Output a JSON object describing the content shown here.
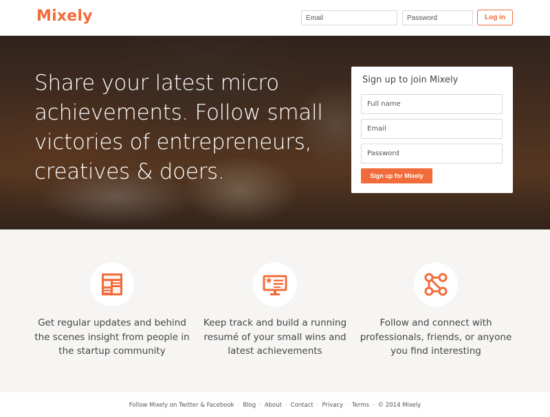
{
  "header": {
    "logo": "Mixely",
    "email_placeholder": "Email",
    "password_placeholder": "Password",
    "login_label": "Log in"
  },
  "hero": {
    "headline": "Share your latest micro achievements. Follow small victories of entrepreneurs, creatives & doers."
  },
  "signup": {
    "title": "Sign up to join Mixely",
    "fullname_placeholder": "Full name",
    "email_placeholder": "Email",
    "password_placeholder": "Password",
    "button_label": "Sign up for Mixely"
  },
  "features": [
    {
      "icon": "news-feed-icon",
      "text": "Get regular updates and behind the scenes insight from people in the startup community"
    },
    {
      "icon": "achievement-screen-icon",
      "text": "Keep track and build a running resumé of your small wins and latest achievements"
    },
    {
      "icon": "connections-icon",
      "text": "Follow and connect with professionals, friends, or anyone you find interesting"
    }
  ],
  "footer": {
    "follow": "Follow Mixely on Twitter & Facebook",
    "blog": "Blog",
    "about": "About",
    "contact": "Contact",
    "privacy": "Privacy",
    "terms": "Terms",
    "copyright": "© 2014 Mixely",
    "separator": "·"
  },
  "colors": {
    "accent": "#f26b3a",
    "features_bg": "#f6f5f3"
  }
}
